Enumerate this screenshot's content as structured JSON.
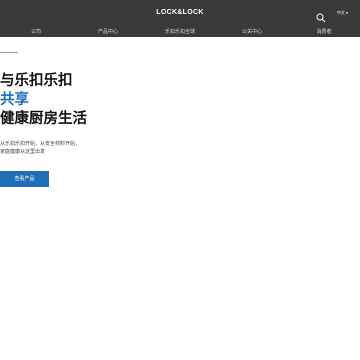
{
  "header": {
    "logo": "LOCK&LOCK",
    "search_icon": "search-icon",
    "language": "中文"
  },
  "nav": {
    "items": [
      {
        "label": "公司"
      },
      {
        "label": "产品中心"
      },
      {
        "label": "乐扣乐扣全球"
      },
      {
        "label": "公关中心"
      },
      {
        "label": "消费者"
      }
    ]
  },
  "hero": {
    "headline_1": "与乐扣乐扣",
    "headline_2": "共享",
    "headline_3": "健康厨房生活",
    "description_1": "从乐扣乐扣开始，从安全材料开始，",
    "description_2": "家庭健康从这里出发",
    "cta_label": "查看产品"
  },
  "colors": {
    "header_bg": "#3a3a3a",
    "accent": "#1e6fb8",
    "headline": "#111111"
  }
}
